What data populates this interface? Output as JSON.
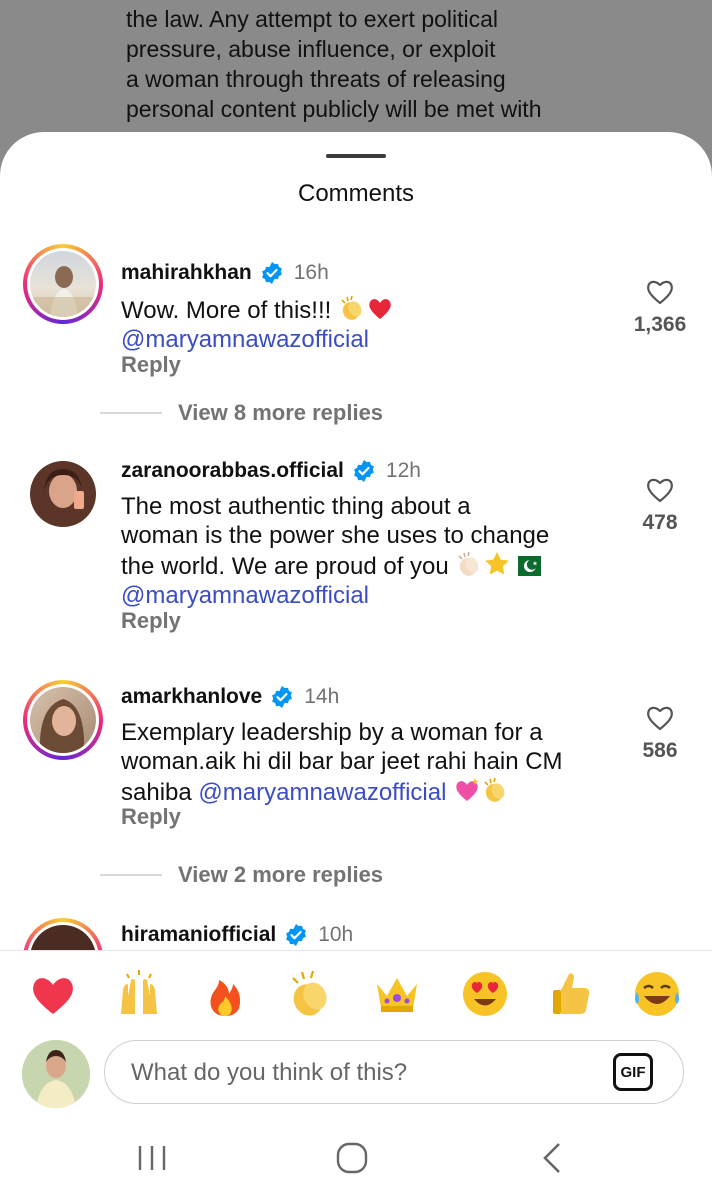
{
  "background_post": {
    "lines": [
      "the law. Any attempt to exert political",
      "pressure, abuse influence, or exploit",
      "a woman through threats of releasing",
      "personal content publicly will be met with"
    ]
  },
  "sheet": {
    "title": "Comments"
  },
  "comments": [
    {
      "username": "mahirahkhan",
      "time": "16h",
      "text_lines": [
        "Wow. More of this!!!"
      ],
      "mention": "@maryamnawazofficial",
      "reply_label": "Reply",
      "likes": "1,366",
      "more_replies": "View 8 more replies",
      "has_story_ring": true
    },
    {
      "username": "zaranoorabbas.official",
      "time": "12h",
      "text_lines": [
        "The most authentic thing about a",
        "woman is the power she uses to change",
        "the world. We are proud of you"
      ],
      "mention": "@maryamnawazofficial",
      "reply_label": "Reply",
      "likes": "478",
      "has_story_ring": false
    },
    {
      "username": "amarkhanlove",
      "time": "14h",
      "text_lines": [
        "Exemplary leadership by a woman for a",
        "woman.aik hi dil bar bar jeet rahi hain CM",
        "sahiba"
      ],
      "mention": "@maryamnawazofficial",
      "reply_label": "Reply",
      "likes": "586",
      "more_replies": "View 2 more replies",
      "has_story_ring": true
    },
    {
      "username": "hiramaniofficial",
      "time": "10h",
      "has_story_ring": true
    }
  ],
  "reactions": [
    "red-heart",
    "raising-hands",
    "fire",
    "clapping-hands",
    "crown",
    "heart-eyes",
    "thumbs-up",
    "tears-of-joy"
  ],
  "composer": {
    "placeholder": "What do you think of this?",
    "gif_label": "GIF"
  },
  "colors": {
    "mention": "#3b4cc4",
    "verified": "#0095f6",
    "secondary_text": "#737373"
  }
}
